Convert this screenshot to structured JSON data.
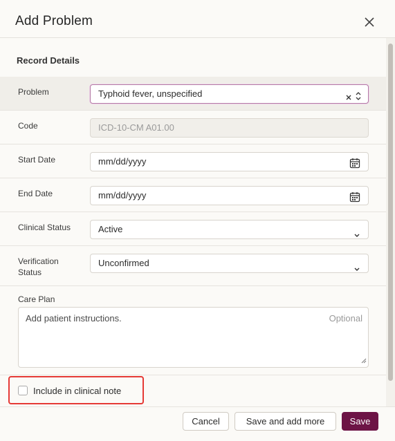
{
  "modal": {
    "title": "Add Problem",
    "section_title": "Record Details"
  },
  "fields": {
    "problem": {
      "label": "Problem",
      "value": "Typhoid fever, unspecified"
    },
    "code": {
      "label": "Code",
      "value": "ICD-10-CM A01.00"
    },
    "start_date": {
      "label": "Start Date",
      "placeholder": "mm/dd/yyyy"
    },
    "end_date": {
      "label": "End Date",
      "placeholder": "mm/dd/yyyy"
    },
    "clinical_status": {
      "label": "Clinical Status",
      "value": "Active"
    },
    "verification_status": {
      "label": "Verification\nStatus",
      "label_line1": "Verification",
      "label_line2": "Status",
      "value": "Unconfirmed"
    },
    "care_plan": {
      "label": "Care Plan",
      "placeholder": "Add patient instructions.",
      "hint": "Optional"
    }
  },
  "checkbox": {
    "label": "Include in clinical note",
    "checked": false
  },
  "footer": {
    "cancel_label": "Cancel",
    "save_add_label": "Save and add more",
    "save_label": "Save"
  },
  "colors": {
    "primary": "#6d1446",
    "focus_border": "#b47aa5",
    "highlight_border": "#e53935"
  },
  "icons": [
    "close-icon",
    "clear-icon",
    "sort-icon",
    "calendar-icon",
    "chevron-down-icon",
    "resize-handle-icon"
  ]
}
